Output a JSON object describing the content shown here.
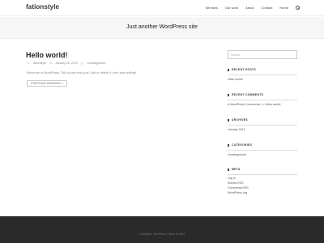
{
  "header": {
    "site_title": "fationstyle",
    "nav": [
      "Services",
      "Our work",
      "About",
      "Contact",
      "Home"
    ]
  },
  "band": {
    "tagline": "Just another WordPress site"
  },
  "post": {
    "title": "Hello world!",
    "author": "fationstyle",
    "date": "January 28, 2019",
    "category": "Uncategorized",
    "excerpt": "Welcome to WordPress. This is your first post. Edit or delete it, then start writing!",
    "continue_label": "CONTINUE READING »"
  },
  "sidebar": {
    "search_placeholder": "Search",
    "recent_posts_title": "RECENT POSTS",
    "recent_posts": [
      "Hello world!"
    ],
    "recent_comments_title": "RECENT COMMENTS",
    "recent_comment": {
      "author": "A WordPress Commenter",
      "on": "on",
      "post": "Hello world!"
    },
    "archives_title": "ARCHIVES",
    "archives": [
      "January 2019"
    ],
    "categories_title": "CATEGORIES",
    "categories": [
      "Uncategorized"
    ],
    "meta_title": "META",
    "meta": [
      "Log in",
      "Entries RSS",
      "Comments RSS",
      "WordPress.org"
    ]
  },
  "footer": {
    "copyright": "Copyright - OnePress Theme by Ned"
  }
}
